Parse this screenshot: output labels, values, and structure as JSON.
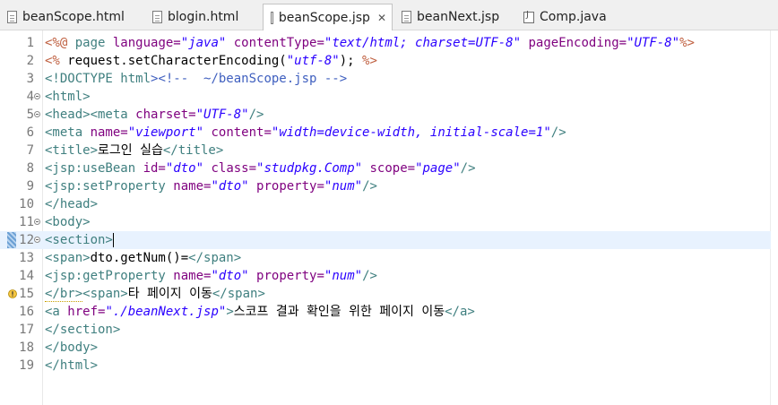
{
  "tabs": [
    {
      "label": "beanScope.html",
      "icon": "html-file-icon",
      "active": false
    },
    {
      "label": "blogin.html",
      "icon": "html-file-icon",
      "active": false
    },
    {
      "label": "beanScope.jsp",
      "icon": "jsp-file-icon",
      "active": true,
      "close": "✕"
    },
    {
      "label": "beanNext.jsp",
      "icon": "jsp-file-icon",
      "active": false
    },
    {
      "label": "Comp.java",
      "icon": "java-file-icon",
      "active": false
    }
  ],
  "lines": [
    {
      "n": "1",
      "fold": false,
      "current": false,
      "segs": [
        {
          "c": "jsp",
          "t": "<%@ "
        },
        {
          "c": "tag",
          "t": "page "
        },
        {
          "c": "attr",
          "t": "language="
        },
        {
          "c": "val",
          "t": "\"java\""
        },
        {
          "c": "attr",
          "t": " contentType="
        },
        {
          "c": "val",
          "t": "\"text/html; charset=UTF-8\""
        },
        {
          "c": "attr",
          "t": " pageEncoding="
        },
        {
          "c": "val",
          "t": "\"UTF-8\""
        },
        {
          "c": "jsp",
          "t": "%>"
        }
      ]
    },
    {
      "n": "2",
      "fold": false,
      "current": false,
      "segs": [
        {
          "c": "jsp",
          "t": "<%"
        },
        {
          "c": "plain",
          "t": " request.setCharacterEncoding("
        },
        {
          "c": "val",
          "t": "\"utf-8\""
        },
        {
          "c": "plain",
          "t": "); "
        },
        {
          "c": "jsp",
          "t": "%>"
        }
      ]
    },
    {
      "n": "3",
      "fold": false,
      "current": false,
      "segs": [
        {
          "c": "tag",
          "t": "<!DOCTYPE "
        },
        {
          "c": "tag",
          "t": "html"
        },
        {
          "c": "com",
          "t": "><!--  ~/beanScope.jsp -->"
        }
      ]
    },
    {
      "n": "4",
      "fold": true,
      "current": false,
      "segs": [
        {
          "c": "tag",
          "t": "<html>"
        }
      ]
    },
    {
      "n": "5",
      "fold": true,
      "current": false,
      "segs": [
        {
          "c": "tag",
          "t": "<head><meta "
        },
        {
          "c": "attr",
          "t": "charset="
        },
        {
          "c": "val",
          "t": "\"UTF-8\""
        },
        {
          "c": "tag",
          "t": "/>"
        }
      ]
    },
    {
      "n": "6",
      "fold": false,
      "current": false,
      "segs": [
        {
          "c": "tag",
          "t": "<meta "
        },
        {
          "c": "attr",
          "t": "name="
        },
        {
          "c": "val",
          "t": "\"viewport\""
        },
        {
          "c": "attr",
          "t": " content="
        },
        {
          "c": "val",
          "t": "\"width=device-width, initial-scale=1\""
        },
        {
          "c": "tag",
          "t": "/>"
        }
      ]
    },
    {
      "n": "7",
      "fold": false,
      "current": false,
      "segs": [
        {
          "c": "tag",
          "t": "<title>"
        },
        {
          "c": "plain",
          "t": "로그인 실습"
        },
        {
          "c": "tag",
          "t": "</title>"
        }
      ]
    },
    {
      "n": "8",
      "fold": false,
      "current": false,
      "segs": [
        {
          "c": "tag",
          "t": "<jsp:useBean "
        },
        {
          "c": "attr",
          "t": "id="
        },
        {
          "c": "val",
          "t": "\"dto\""
        },
        {
          "c": "attr",
          "t": " class="
        },
        {
          "c": "val",
          "t": "\"studpkg.Comp\""
        },
        {
          "c": "attr",
          "t": " scope="
        },
        {
          "c": "val",
          "t": "\"page\""
        },
        {
          "c": "tag",
          "t": "/>"
        }
      ]
    },
    {
      "n": "9",
      "fold": false,
      "current": false,
      "segs": [
        {
          "c": "tag",
          "t": "<jsp:setProperty "
        },
        {
          "c": "attr",
          "t": "name="
        },
        {
          "c": "val",
          "t": "\"dto\""
        },
        {
          "c": "attr",
          "t": " property="
        },
        {
          "c": "val",
          "t": "\"num\""
        },
        {
          "c": "tag",
          "t": "/>"
        }
      ]
    },
    {
      "n": "10",
      "fold": false,
      "current": false,
      "segs": [
        {
          "c": "tag",
          "t": "</head>"
        }
      ]
    },
    {
      "n": "11",
      "fold": true,
      "current": false,
      "segs": [
        {
          "c": "tag",
          "t": "<body>"
        }
      ]
    },
    {
      "n": "12",
      "fold": true,
      "current": true,
      "segs": [
        {
          "c": "tag",
          "t": "<section>"
        }
      ]
    },
    {
      "n": "13",
      "fold": false,
      "current": false,
      "segs": [
        {
          "c": "tag",
          "t": "<span>"
        },
        {
          "c": "plain",
          "t": "dto.getNum()="
        },
        {
          "c": "tag",
          "t": "</span>"
        }
      ]
    },
    {
      "n": "14",
      "fold": false,
      "current": false,
      "segs": [
        {
          "c": "tag",
          "t": "<jsp:getProperty "
        },
        {
          "c": "attr",
          "t": "name="
        },
        {
          "c": "val",
          "t": "\"dto\""
        },
        {
          "c": "attr",
          "t": " property="
        },
        {
          "c": "val",
          "t": "\"num\""
        },
        {
          "c": "tag",
          "t": "/>"
        }
      ]
    },
    {
      "n": "15",
      "fold": false,
      "current": false,
      "warn": true,
      "segs": [
        {
          "c": "tag",
          "t": "</br>",
          "warn": true
        },
        {
          "c": "tag",
          "t": "<span>"
        },
        {
          "c": "plain",
          "t": "타 페이지 이동"
        },
        {
          "c": "tag",
          "t": "</span>"
        }
      ]
    },
    {
      "n": "16",
      "fold": false,
      "current": false,
      "segs": [
        {
          "c": "tag",
          "t": "<a "
        },
        {
          "c": "attr",
          "t": "href="
        },
        {
          "c": "val",
          "t": "\"./beanNext.jsp\""
        },
        {
          "c": "tag",
          "t": ">"
        },
        {
          "c": "plain",
          "t": "스코프 결과 확인을 위한 페이지 이동"
        },
        {
          "c": "tag",
          "t": "</a>"
        }
      ]
    },
    {
      "n": "17",
      "fold": false,
      "current": false,
      "segs": [
        {
          "c": "tag",
          "t": "</section>"
        }
      ]
    },
    {
      "n": "18",
      "fold": false,
      "current": false,
      "segs": [
        {
          "c": "tag",
          "t": "</body>"
        }
      ]
    },
    {
      "n": "19",
      "fold": false,
      "current": false,
      "segs": [
        {
          "c": "tag",
          "t": "</html>"
        }
      ]
    }
  ],
  "colors": {
    "tag": "#3f7f7f",
    "attr": "#7f007f",
    "value": "#2a00ff",
    "jsp": "#bf5f3f",
    "current_line": "#e8f2fe"
  }
}
